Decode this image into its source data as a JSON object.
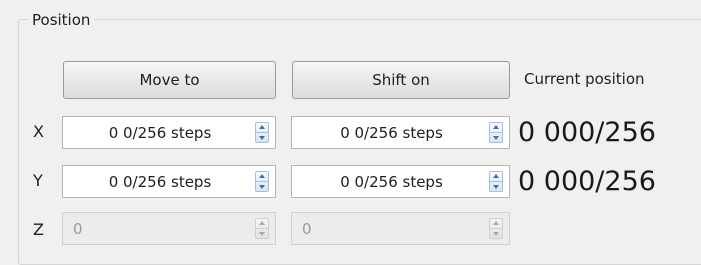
{
  "group": {
    "title": "Position"
  },
  "buttons": {
    "move_to": "Move to",
    "shift_on": "Shift on"
  },
  "current_position_label": "Current position",
  "axes": [
    {
      "label": "X",
      "move_value": "0 0/256 steps",
      "shift_value": "0 0/256 steps",
      "current": "0 000/256",
      "enabled": true
    },
    {
      "label": "Y",
      "move_value": "0 0/256 steps",
      "shift_value": "0 0/256 steps",
      "current": "0 000/256",
      "enabled": true
    },
    {
      "label": "Z",
      "move_value": "0",
      "shift_value": "0",
      "current": "",
      "enabled": false
    }
  ],
  "icons": {
    "spin_up": "spin-up-arrow-icon",
    "spin_down": "spin-down-arrow-icon"
  },
  "colors": {
    "arrow_blue": "#3d6fb0",
    "disabled_text": "#9a9a9a"
  }
}
